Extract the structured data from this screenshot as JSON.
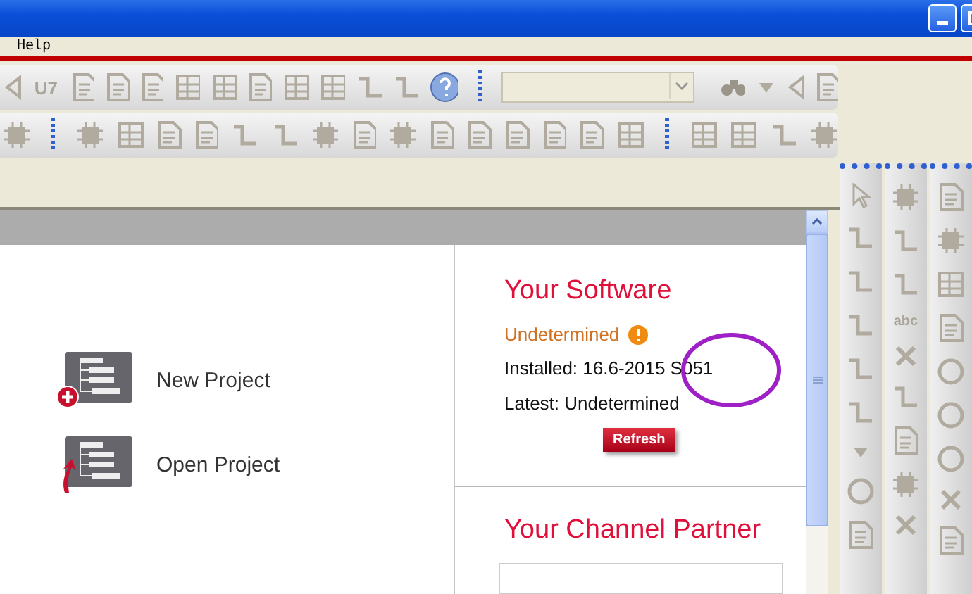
{
  "menu": [
    {
      "label": "Help"
    }
  ],
  "toolbars": [
    {
      "icons": [
        {
          "kind": "arrow"
        },
        {
          "kind": "text",
          "label": "U7"
        },
        {
          "kind": "document"
        },
        {
          "kind": "document"
        },
        {
          "kind": "document"
        },
        {
          "kind": "grid"
        },
        {
          "kind": "grid"
        },
        {
          "kind": "document"
        },
        {
          "kind": "grid"
        },
        {
          "kind": "grid"
        },
        {
          "kind": "wire"
        },
        {
          "kind": "wire"
        },
        {
          "kind": "help"
        },
        {
          "kind": "grip"
        },
        {
          "kind": "combo"
        },
        {
          "kind": "binoculars"
        },
        {
          "kind": "caret"
        },
        {
          "kind": "arrow"
        },
        {
          "kind": "document"
        }
      ]
    },
    {
      "icons": [
        {
          "kind": "chip"
        },
        {
          "kind": "grip"
        },
        {
          "kind": "chip"
        },
        {
          "kind": "grid"
        },
        {
          "kind": "document"
        },
        {
          "kind": "document"
        },
        {
          "kind": "wire"
        },
        {
          "kind": "wire"
        },
        {
          "kind": "chip"
        },
        {
          "kind": "document"
        },
        {
          "kind": "chip"
        },
        {
          "kind": "document"
        },
        {
          "kind": "document"
        },
        {
          "kind": "document"
        },
        {
          "kind": "document"
        },
        {
          "kind": "document"
        },
        {
          "kind": "grid"
        },
        {
          "kind": "grip"
        },
        {
          "kind": "grid"
        },
        {
          "kind": "grid"
        },
        {
          "kind": "wire"
        },
        {
          "kind": "chip"
        }
      ]
    }
  ],
  "palette": [
    {
      "icons": [
        {
          "kind": "pointer"
        },
        {
          "kind": "wire"
        },
        {
          "kind": "wire"
        },
        {
          "kind": "wire"
        },
        {
          "kind": "wire"
        },
        {
          "kind": "wire"
        },
        {
          "kind": "caret"
        },
        {
          "kind": "circle"
        },
        {
          "kind": "document"
        }
      ]
    },
    {
      "icons": [
        {
          "kind": "chip"
        },
        {
          "kind": "wire"
        },
        {
          "kind": "wire"
        },
        {
          "kind": "text",
          "label": "abc"
        },
        {
          "kind": "cross"
        },
        {
          "kind": "wire"
        },
        {
          "kind": "document"
        },
        {
          "kind": "chip"
        },
        {
          "kind": "cross"
        }
      ]
    },
    {
      "icons": [
        {
          "kind": "document"
        },
        {
          "kind": "chip"
        },
        {
          "kind": "grid"
        },
        {
          "kind": "document"
        },
        {
          "kind": "circle"
        },
        {
          "kind": "circle"
        },
        {
          "kind": "circle"
        },
        {
          "kind": "cross"
        },
        {
          "kind": "document"
        }
      ]
    }
  ],
  "start": [
    {
      "kind": "new",
      "label": "New Project"
    },
    {
      "kind": "open",
      "label": "Open Project"
    }
  ],
  "software": {
    "title": "Your Software",
    "status": "Undetermined",
    "installed": "Installed: 16.6-2015 S051",
    "latest": "Latest: Undetermined",
    "button": "Refresh"
  },
  "partner": {
    "title": "Your Channel Partner"
  }
}
